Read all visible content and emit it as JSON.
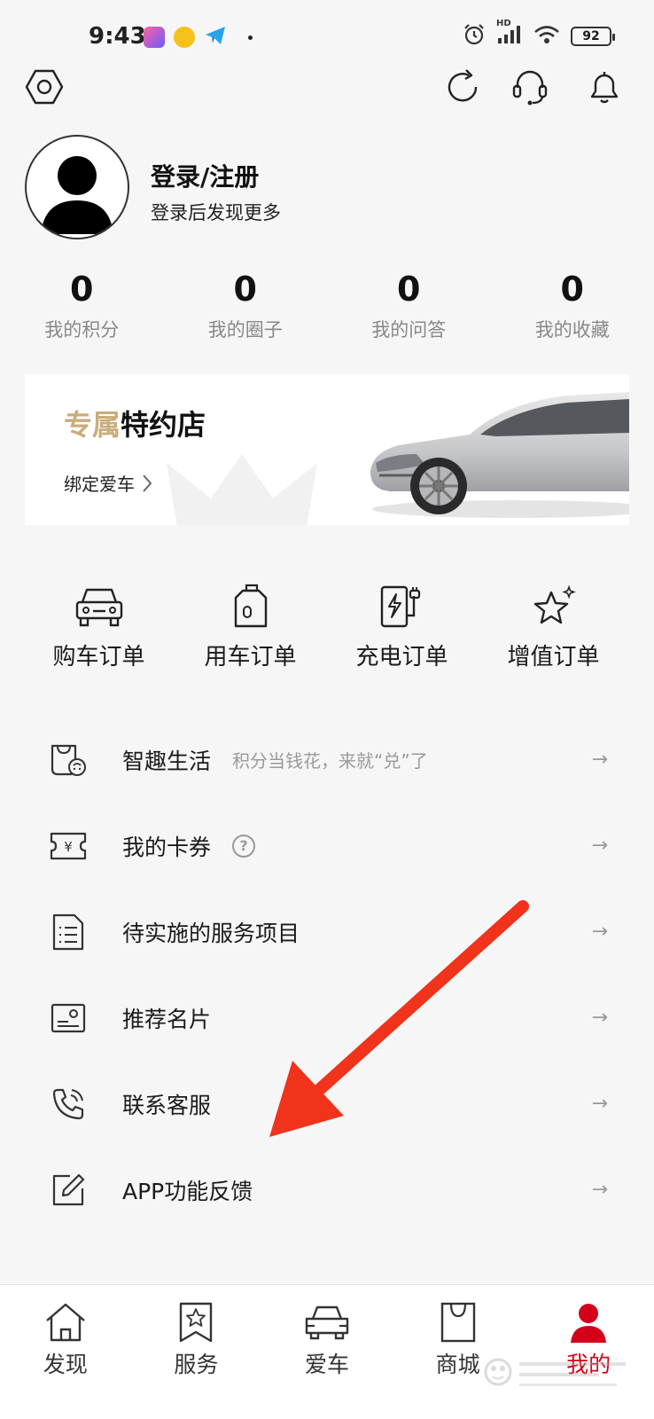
{
  "status_bar": {
    "time": "9:43",
    "battery": "92",
    "network_label": "HD"
  },
  "profile": {
    "title": "登录/注册",
    "subtitle": "登录后发现更多"
  },
  "stats": [
    {
      "value": "0",
      "label": "我的积分"
    },
    {
      "value": "0",
      "label": "我的圈子"
    },
    {
      "value": "0",
      "label": "我的问答"
    },
    {
      "value": "0",
      "label": "我的收藏"
    }
  ],
  "banner": {
    "title_highlight": "专属",
    "title_rest": "特约店",
    "link_label": "绑定爱车"
  },
  "orders": [
    {
      "label": "购车订单",
      "icon": "car-front-icon"
    },
    {
      "label": "用车订单",
      "icon": "fuel-can-icon"
    },
    {
      "label": "充电订单",
      "icon": "charger-icon"
    },
    {
      "label": "增值订单",
      "icon": "star-icon"
    }
  ],
  "menu": {
    "items": [
      {
        "label": "智趣生活",
        "hint": "积分当钱花，来就“兑”了",
        "icon": "coffee-cup-icon"
      },
      {
        "label": "我的卡券",
        "hint": "?",
        "icon": "ticket-icon"
      },
      {
        "label": "待实施的服务项目",
        "icon": "document-list-icon"
      },
      {
        "label": "推荐名片",
        "icon": "business-card-icon"
      },
      {
        "label": "联系客服",
        "icon": "phone-icon"
      },
      {
        "label": "APP功能反馈",
        "icon": "edit-icon"
      }
    ],
    "arrow": "→"
  },
  "tabs": [
    {
      "label": "发现",
      "icon": "home-icon",
      "active": false
    },
    {
      "label": "服务",
      "icon": "bookmark-star-icon",
      "active": false
    },
    {
      "label": "爱车",
      "icon": "car-icon",
      "active": false
    },
    {
      "label": "商城",
      "icon": "shopping-bag-icon",
      "active": false
    },
    {
      "label": "我的",
      "icon": "user-icon",
      "active": true
    }
  ],
  "colors": {
    "accent": "#d4001a",
    "gold": "#c9ad7c",
    "annotation": "#f0331a"
  }
}
